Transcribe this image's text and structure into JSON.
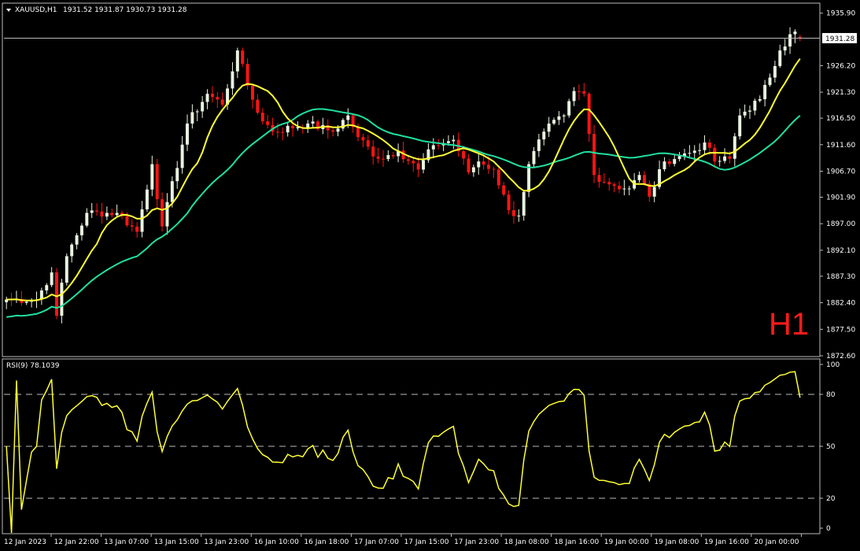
{
  "header": {
    "symbol": "XAUUSD,H1",
    "ohlc": "1931.52 1931.87 1930.73 1931.28"
  },
  "timeframe_label": "H1",
  "colors": {
    "background": "#000000",
    "bull_candle": "#e8f4e0",
    "bear_candle": "#ff1414",
    "ma_fast": "#ffff33",
    "ma_slow": "#20e0a0",
    "rsi_line": "#ffff33",
    "grid": "#bbbbbb",
    "frame": "#bbbbbb",
    "text": "#ffffff"
  },
  "icons": {
    "header_arrow": "triangle-down-icon"
  },
  "chart_data": [
    {
      "type": "candlestick",
      "title": "XAUUSD,H1",
      "ylim": [
        1872.6,
        1937.6
      ],
      "yticks": [
        "1935.90",
        "1926.20",
        "1921.30",
        "1916.50",
        "1911.60",
        "1906.70",
        "1901.90",
        "1897.00",
        "1892.10",
        "1887.30",
        "1882.40",
        "1877.50",
        "1872.60"
      ],
      "current_price": "1931.28",
      "x_tick_labels": [
        "12 Jan 2023",
        "12 Jan 22:00",
        "13 Jan 07:00",
        "13 Jan 15:00",
        "13 Jan 23:00",
        "16 Jan 10:00",
        "16 Jan 18:00",
        "17 Jan 07:00",
        "17 Jan 15:00",
        "17 Jan 23:00",
        "18 Jan 08:00",
        "18 Jan 16:00",
        "19 Jan 00:00",
        "19 Jan 08:00",
        "19 Jan 16:00",
        "20 Jan 00:00"
      ],
      "close_keypoints": [
        [
          0,
          1883.0
        ],
        [
          6,
          1883.0
        ],
        [
          9,
          1888.0
        ],
        [
          10,
          1880.0
        ],
        [
          12,
          1891.0
        ],
        [
          16,
          1899.0
        ],
        [
          22,
          1899.0
        ],
        [
          26,
          1895.5
        ],
        [
          29,
          1908.0
        ],
        [
          31,
          1896.5
        ],
        [
          36,
          1915.5
        ],
        [
          40,
          1921.0
        ],
        [
          43,
          1919.0
        ],
        [
          46,
          1929.0
        ],
        [
          48,
          1922.5
        ],
        [
          50,
          1917.5
        ],
        [
          53,
          1914.0
        ],
        [
          60,
          1915.5
        ],
        [
          65,
          1914.0
        ],
        [
          68,
          1917.0
        ],
        [
          70,
          1913.0
        ],
        [
          74,
          1909.0
        ],
        [
          78,
          1910.5
        ],
        [
          82,
          1907.0
        ],
        [
          85,
          1911.5
        ],
        [
          89,
          1912.5
        ],
        [
          92,
          1906.5
        ],
        [
          94,
          1908.5
        ],
        [
          97,
          1907.0
        ],
        [
          100,
          1899.5
        ],
        [
          102,
          1898.5
        ],
        [
          104,
          1908.0
        ],
        [
          107,
          1914.0
        ],
        [
          111,
          1917.0
        ],
        [
          113,
          1921.5
        ],
        [
          115,
          1921.0
        ],
        [
          117,
          1906.0
        ],
        [
          121,
          1904.0
        ],
        [
          124,
          1903.5
        ],
        [
          126,
          1906.0
        ],
        [
          128,
          1902.0
        ],
        [
          131,
          1908.5
        ],
        [
          134,
          1909.5
        ],
        [
          137,
          1910.5
        ],
        [
          139,
          1912.0
        ],
        [
          141,
          1908.5
        ],
        [
          144,
          1909.0
        ],
        [
          146,
          1917.0
        ],
        [
          150,
          1920.0
        ],
        [
          152,
          1924.0
        ],
        [
          154,
          1929.0
        ],
        [
          156,
          1932.0
        ],
        [
          157,
          1932.5
        ],
        [
          158,
          1931.28
        ]
      ],
      "series": [
        {
          "name": "MA fast",
          "period": 9
        },
        {
          "name": "MA slow",
          "period": 27
        }
      ]
    },
    {
      "type": "line",
      "title": "RSI(9) 78.1039",
      "ylim": [
        0,
        100
      ],
      "yticks": [
        "100",
        "80",
        "50",
        "20",
        "0"
      ],
      "levels": [
        80,
        50,
        20
      ],
      "series": [
        {
          "name": "RSI(9)",
          "values": []
        }
      ]
    }
  ]
}
